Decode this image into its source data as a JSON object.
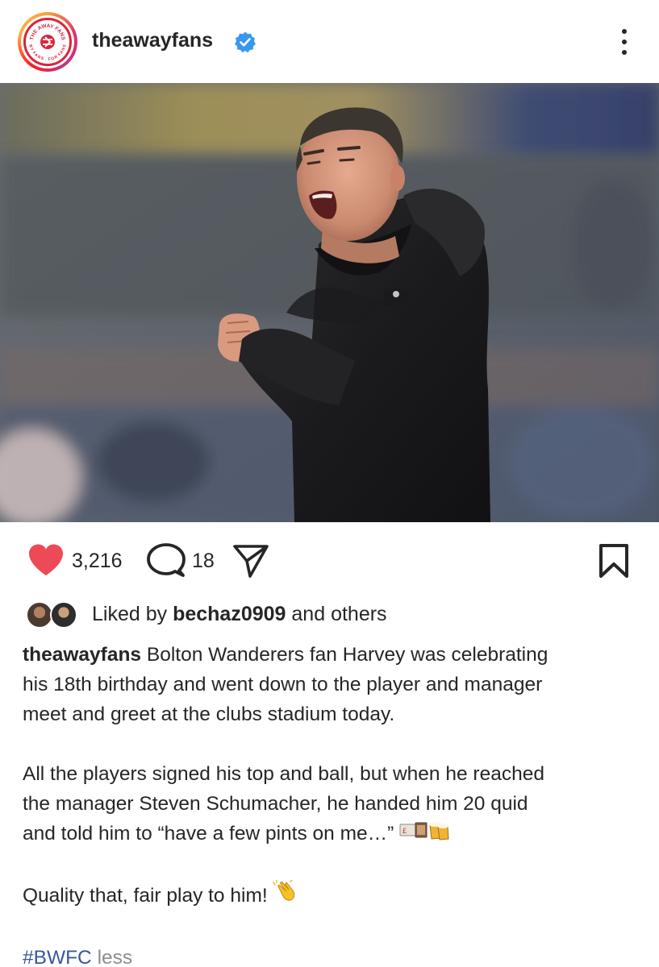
{
  "post": {
    "username": "theawayfans",
    "verified": true,
    "likes": "3,216",
    "comments": "18",
    "liked_by_prefix": "Liked by",
    "liked_by_user": "bechaz0909",
    "liked_by_suffix": "and others",
    "caption_user": "theawayfans",
    "caption_line1": "Bolton Wanderers fan Harvey was celebrating",
    "caption_line2": "his 18th birthday and went down to the player and manager",
    "caption_line3": "meet and greet at the clubs stadium today.",
    "caption_line4": "All the players signed his top and ball, but when he reached",
    "caption_line5": "the manager Steven Schumacher, he handed him 20 quid",
    "caption_line6": "and told him to “have a few pints on me…”",
    "caption_line7": "Quality that, fair play to him!",
    "hashtag": "#BWFC",
    "less_label": "less"
  },
  "logo_text": {
    "top": "THE AWAY FANS",
    "bottom": "BY FANS . FOR FANS"
  },
  "icons": {
    "like": "heart-icon",
    "comment": "comment-icon",
    "share": "paper-plane-icon",
    "save": "bookmark-icon",
    "more": "more-options-icon",
    "verified": "verified-badge-icon"
  },
  "colors": {
    "like_red": "#ed4956",
    "verified_blue": "#3897f0",
    "hashtag": "#385898",
    "muted": "#8e8e8e",
    "logo_red": "#d9263b"
  }
}
